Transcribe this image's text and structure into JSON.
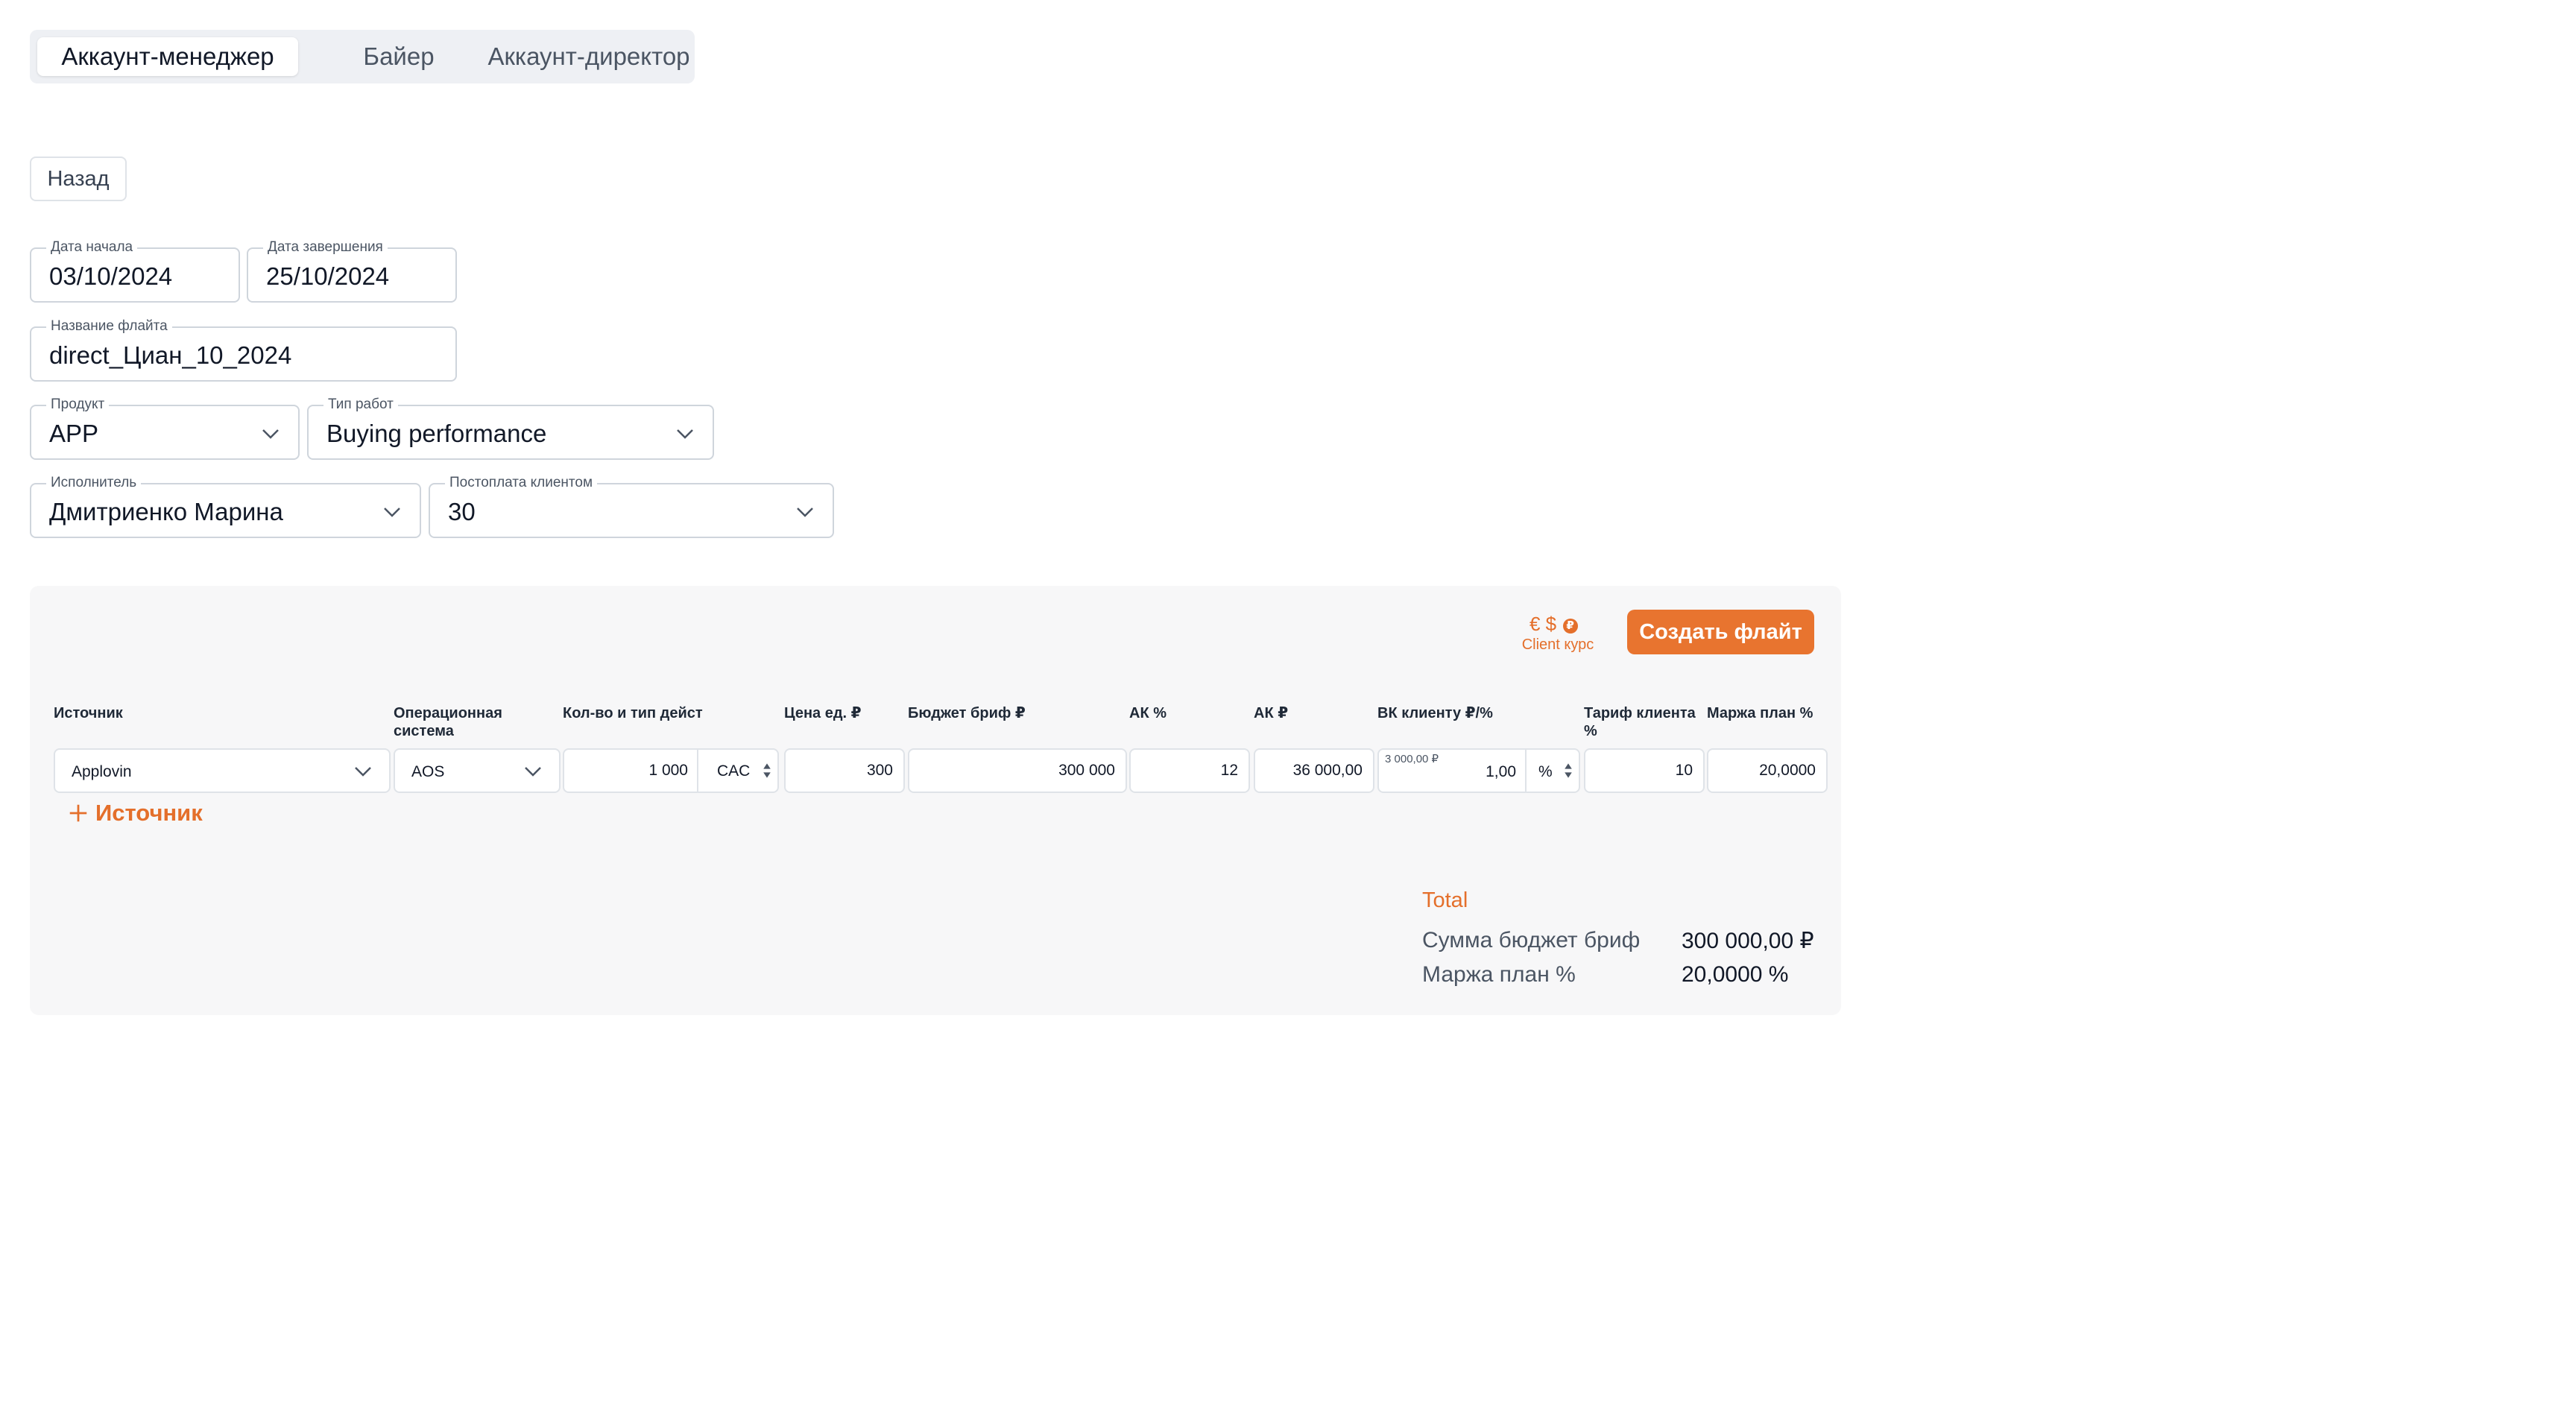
{
  "tabs": [
    "Аккаунт-менеджер",
    "Байер",
    "Аккаунт-директор"
  ],
  "back_label": "Назад",
  "form": {
    "start_date": {
      "label": "Дата начала",
      "value": "03/10/2024"
    },
    "end_date": {
      "label": "Дата завершения",
      "value": "25/10/2024"
    },
    "flight_name": {
      "label": "Название флайта",
      "value": "direct_Циан_10_2024"
    },
    "product": {
      "label": "Продукт",
      "value": "APP"
    },
    "work_type": {
      "label": "Тип работ",
      "value": "Buying performance"
    },
    "executor": {
      "label": "Исполнитель",
      "value": "Дмитриенко Марина"
    },
    "postpay": {
      "label": "Постоплата клиентом",
      "value": "30"
    }
  },
  "panel": {
    "currency_symbols": "€ $",
    "currency_badge": "₽",
    "client_rate_label": "Client курс",
    "create_button": "Создать флайт",
    "columns": {
      "source": "Источник",
      "os_line1": "Операционная",
      "os_line2": "система",
      "qty": "Кол-во и тип дейст",
      "price": "Цена ед. ₽",
      "budget": "Бюджет бриф ₽",
      "ak_pct": "АК %",
      "ak_rub": "АК ₽",
      "vk": "ВК клиенту ₽/%",
      "tariff_line1": "Тариф клиента",
      "tariff_line2": "%",
      "margin": "Маржа план %"
    },
    "row": {
      "source": "Applovin",
      "os": "AOS",
      "qty": "1 000",
      "qty_type": "CAC",
      "price": "300",
      "budget": "300 000",
      "ak_pct": "12",
      "ak_rub": "36 000,00",
      "vk_hint": "3 000,00 ₽",
      "vk_value": "1,00",
      "vk_unit": "%",
      "tariff": "10",
      "margin": "20,0000"
    },
    "add_source": "Источник",
    "total": {
      "title": "Total",
      "budget_label": "Сумма бюджет бриф",
      "budget_value": "300 000,00 ₽",
      "margin_label": "Маржа план %",
      "margin_value": "20,0000 %"
    }
  },
  "colors": {
    "accent": "#e8742f",
    "panel_bg": "#f7f7f8",
    "tabs_bg": "#eef0f4"
  }
}
